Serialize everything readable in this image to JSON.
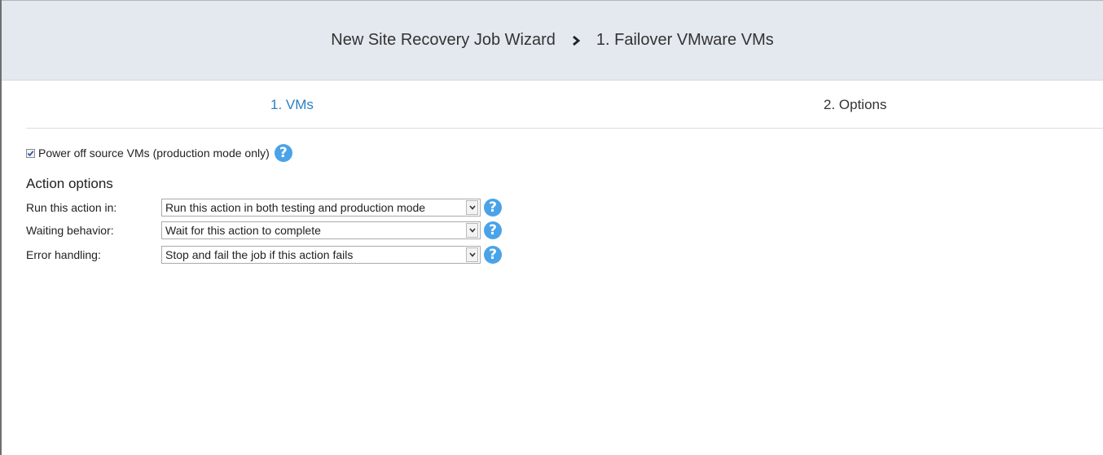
{
  "header": {
    "wizard_title": "New Site Recovery Job Wizard",
    "separator_icon": "chevron-right-icon",
    "step_title": "1. Failover VMware VMs"
  },
  "tabs": [
    {
      "label": "1. VMs",
      "active": true
    },
    {
      "label": "2. Options",
      "active": false
    }
  ],
  "power_off": {
    "checked": true,
    "label": "Power off source VMs (production mode only)",
    "help_icon": "help-icon"
  },
  "action_options": {
    "title": "Action options",
    "rows": [
      {
        "label": "Run this action in:",
        "value": "Run this action in both testing and production mode"
      },
      {
        "label": "Waiting behavior:",
        "value": "Wait for this action to complete"
      },
      {
        "label": "Error handling:",
        "value": "Stop and fail the job if this action fails"
      }
    ]
  },
  "colors": {
    "header_bg": "#e4e8ef",
    "active_tab": "#2a7fc3",
    "help_icon": "#4aa3e8"
  }
}
